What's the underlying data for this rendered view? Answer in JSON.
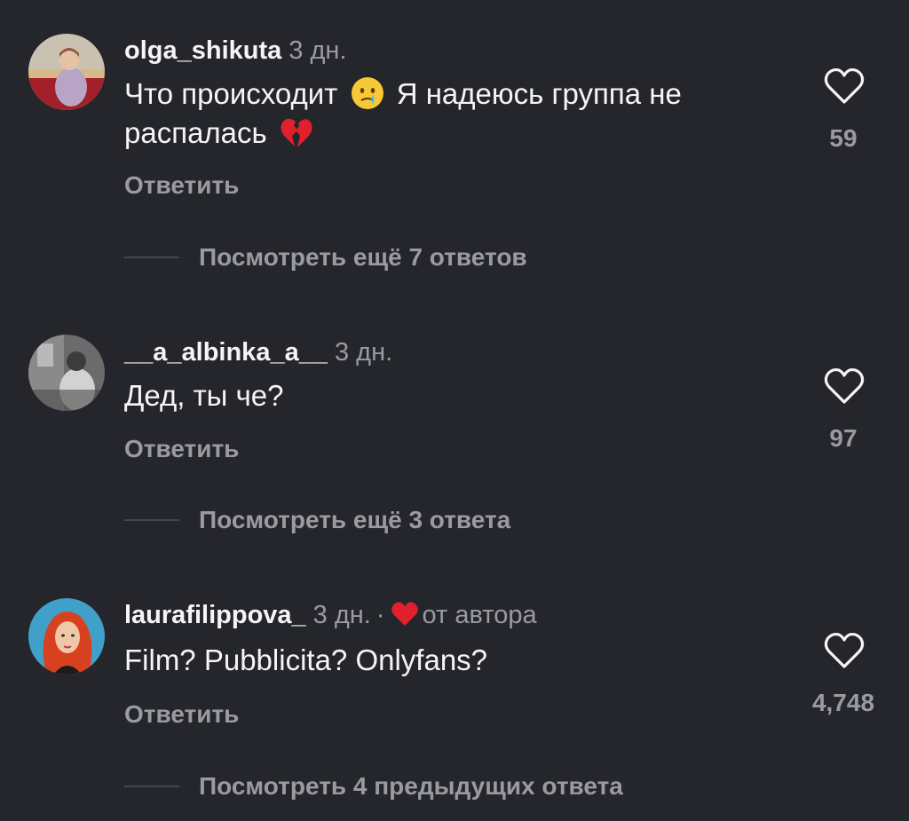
{
  "comments": [
    {
      "username": "olga_shikuta",
      "time": "3 дн.",
      "text_parts": [
        "Что происходит",
        "Я надеюсь группа не распалась"
      ],
      "emojis": [
        "crying-face-emoji",
        "broken-heart-emoji"
      ],
      "reply_label": "Ответить",
      "likes": "59",
      "more_replies": "Посмотреть ещё 7 ответов"
    },
    {
      "username": "__a_albinka_a__",
      "time": "3 дн.",
      "text": "Дед, ты че?",
      "reply_label": "Ответить",
      "likes": "97",
      "more_replies": "Посмотреть ещё 3 ответа"
    },
    {
      "username": "laurafilippova_",
      "time": "3 дн.",
      "dot": "·",
      "author_label": "от автора",
      "text": "Film? Pubblicita? Onlyfans?",
      "reply_label": "Ответить",
      "likes": "4,748",
      "more_replies": "Посмотреть 4 предыдущих ответа"
    }
  ],
  "colors": {
    "background": "#25262b",
    "primary_text": "#f5f5f7",
    "secondary_text": "#9a9ba1",
    "author_heart": "#e0202d"
  },
  "icons": [
    "heart-outline-icon",
    "red-heart-icon"
  ]
}
